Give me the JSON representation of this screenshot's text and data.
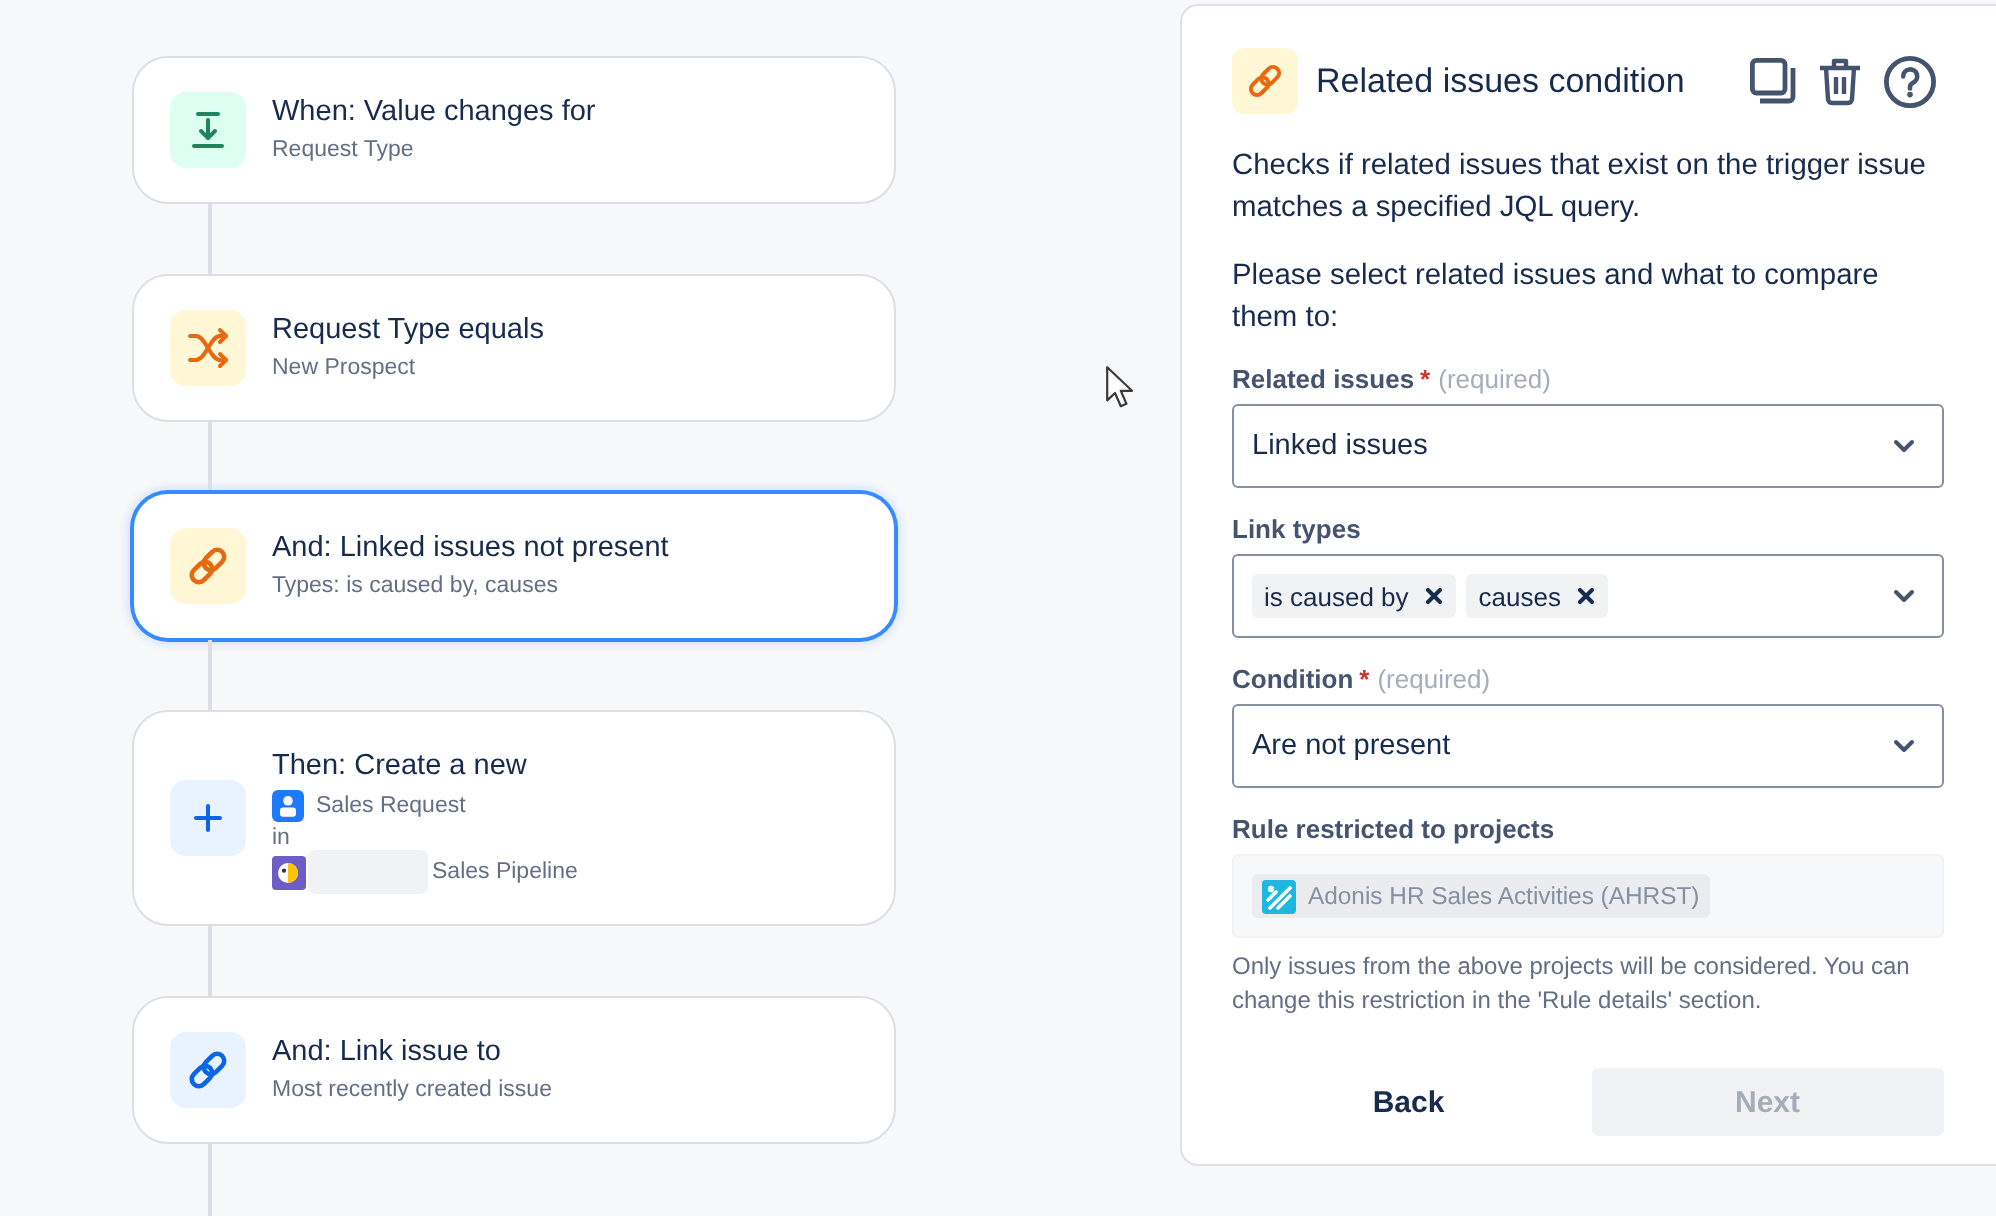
{
  "flow": {
    "steps": [
      {
        "kind": "trigger",
        "title": "When: Value changes for",
        "subtitle": "Request Type",
        "selected": false
      },
      {
        "kind": "condition",
        "title": "Request Type equals",
        "subtitle": "New Prospect",
        "selected": false
      },
      {
        "kind": "related-condition",
        "title": "And: Linked issues not present",
        "subtitle": "Types: is caused by, causes",
        "selected": true
      },
      {
        "kind": "create-action",
        "title": "Then: Create a new",
        "issue_type": "Sales Request",
        "joiner": "in",
        "project_redacted": true,
        "project": "Sales Pipeline",
        "selected": false
      },
      {
        "kind": "link-action",
        "title": "And: Link issue to",
        "subtitle": "Most recently created issue",
        "selected": false
      }
    ]
  },
  "panel": {
    "title": "Related issues condition",
    "paragraphs": [
      "Checks if related issues that exist on the trigger issue matches a specified JQL query.",
      "Please select related issues and what to compare them to:"
    ],
    "fields": [
      {
        "kind": "select",
        "label": "Related issues",
        "required_mark": "*",
        "required_hint": "(required)",
        "value": "Linked issues"
      },
      {
        "kind": "multiselect",
        "label": "Link types",
        "tags": [
          "is caused by",
          "causes"
        ]
      },
      {
        "kind": "select",
        "label": "Condition",
        "required_mark": "*",
        "required_hint": "(required)",
        "value": "Are not present"
      },
      {
        "kind": "projects",
        "label": "Rule restricted to projects",
        "disabled": true,
        "projects": [
          "Adonis HR Sales Activities (AHRST)"
        ],
        "help": "Only issues from the above projects will be considered. You can change this restriction in the 'Rule details' section."
      }
    ],
    "buttons": [
      {
        "label": "Back",
        "disabled": false
      },
      {
        "label": "Next",
        "disabled": true
      }
    ]
  }
}
